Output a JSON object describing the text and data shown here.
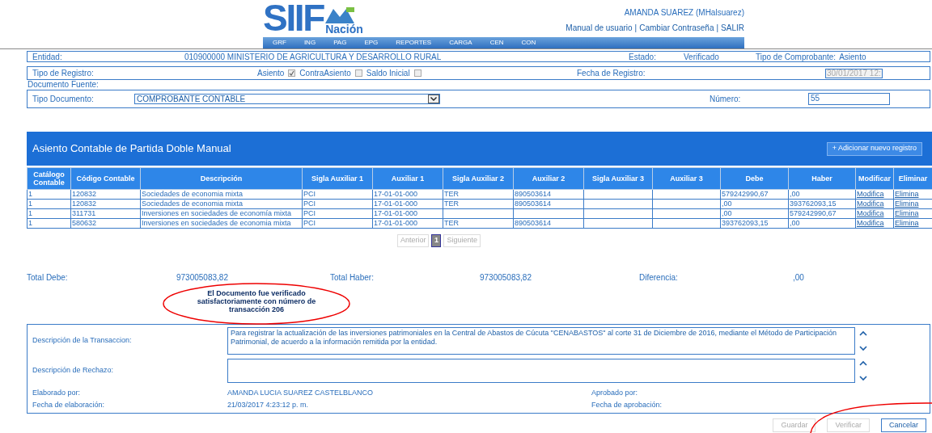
{
  "header": {
    "logo": {
      "main": "SIIF",
      "sub": "Nación"
    },
    "user": "AMANDA SUAREZ (MHalsuarez)",
    "links": [
      "Manual de usuario",
      "Cambiar Contraseña",
      "SALIR"
    ],
    "link_separator": "|",
    "menu": [
      "GRF",
      "ING",
      "PAG",
      "EPG",
      "REPORTES",
      "CARGA",
      "CEN",
      "CON"
    ]
  },
  "form": {
    "entidad": {
      "label": "Entidad:",
      "value": "010900000 MINISTERIO DE AGRICULTURA Y DESARROLLO RURAL"
    },
    "estado": {
      "label": "Estado:",
      "value": "Verificado"
    },
    "tipo_comprobante": {
      "label": "Tipo de Comprobante:",
      "value": "Asiento"
    },
    "tipo_registro": {
      "label": "Tipo de Registro:",
      "options": [
        {
          "label": "Asiento",
          "checked": true
        },
        {
          "label": "ContraAsiento",
          "checked": false
        },
        {
          "label": "Saldo Inicial",
          "checked": false
        }
      ]
    },
    "fecha_registro": {
      "label": "Fecha de Registro:",
      "value": "30/01/2017 12:",
      "disabled": true
    },
    "documento_fuente": "Documento Fuente:",
    "tipo_documento": {
      "label": "Tipo Documento:",
      "value": "COMPROBANTE CONTABLE"
    },
    "numero": {
      "label": "Número:",
      "value": "55"
    }
  },
  "table": {
    "title": "Asiento Contable de Partida Doble Manual",
    "add_button": "+ Adicionar nuevo registro",
    "columns": [
      "Catálogo Contable",
      "Código Contable",
      "Descripción",
      "Sigla Auxiliar 1",
      "Auxiliar 1",
      "Sigla Auxiliar 2",
      "Auxiliar 2",
      "Sigla Auxiliar 3",
      "Auxiliar 3",
      "Debe",
      "Haber",
      "Modificar",
      "Eliminar"
    ],
    "rows": [
      {
        "cells": [
          "1",
          "120832",
          "Sociedades de economia mixta",
          "PCI",
          "17-01-01-000",
          "TER",
          "890503614",
          "",
          "",
          "579242990,67",
          ",00"
        ],
        "modify": "Modifica",
        "delete": "Elimina"
      },
      {
        "cells": [
          "1",
          "120832",
          "Sociedades de economia mixta",
          "PCI",
          "17-01-01-000",
          "TER",
          "890503614",
          "",
          "",
          ",00",
          "393762093,15"
        ],
        "modify": "Modifica",
        "delete": "Elimina"
      },
      {
        "cells": [
          "1",
          "311731",
          "Inversiones en sociedades de economía mixta",
          "PCI",
          "17-01-01-000",
          "",
          "",
          "",
          "",
          ",00",
          "579242990,67"
        ],
        "modify": "Modifica",
        "delete": "Elimina"
      },
      {
        "cells": [
          "1",
          "580632",
          "Inversiones en sociedades de economia mixta",
          "PCI",
          "17-01-01-000",
          "TER",
          "890503614",
          "",
          "",
          "393762093,15",
          ",00"
        ],
        "modify": "Modifica",
        "delete": "Elimina"
      }
    ]
  },
  "pagination": {
    "previous": {
      "label": "Anterior",
      "disabled": true
    },
    "pages": [
      {
        "label": "1",
        "selected": true
      }
    ],
    "next": {
      "label": "Siguiente",
      "disabled": true
    }
  },
  "totals": [
    {
      "label": "Total Debe:",
      "value": "973005083,82"
    },
    {
      "label": "Total Haber:",
      "value": "973005083,82"
    },
    {
      "label": "Diferencia:",
      "value": ",00"
    }
  ],
  "message": "El Documento fue verificado satisfactoriamente con número de transacción 206",
  "details": {
    "descripcion_transaccion": {
      "label": "Descripción de la Transaccion:",
      "value": "Para registrar la actualización de las inversiones patrimoniales en la Central de Abastos de Cúcuta \"CENABASTOS\" al corte 31 de Diciembre de  2016, mediante el Método de Participación Patrimonial, de acuerdo a la información remitida por la entidad."
    },
    "descripcion_rechazo": {
      "label": "Descripción de Rechazo:"
    },
    "elaborado_por": {
      "label": "Elaborado por:",
      "value": "AMANDA LUCIA SUAREZ CASTELBLANCO"
    },
    "aprobado_por": {
      "label": "Aprobado por:"
    },
    "fecha_elaboracion": {
      "label": "Fecha de elaboración:",
      "value": "21/03/2017 4:23:12 p. m."
    },
    "fecha_aprobacion": {
      "label": "Fecha de aprobación:"
    }
  },
  "buttons": [
    {
      "label": "Guardar",
      "disabled": true
    },
    {
      "label": "Verificar",
      "disabled": true
    },
    {
      "label": "Cancelar",
      "disabled": false
    }
  ]
}
